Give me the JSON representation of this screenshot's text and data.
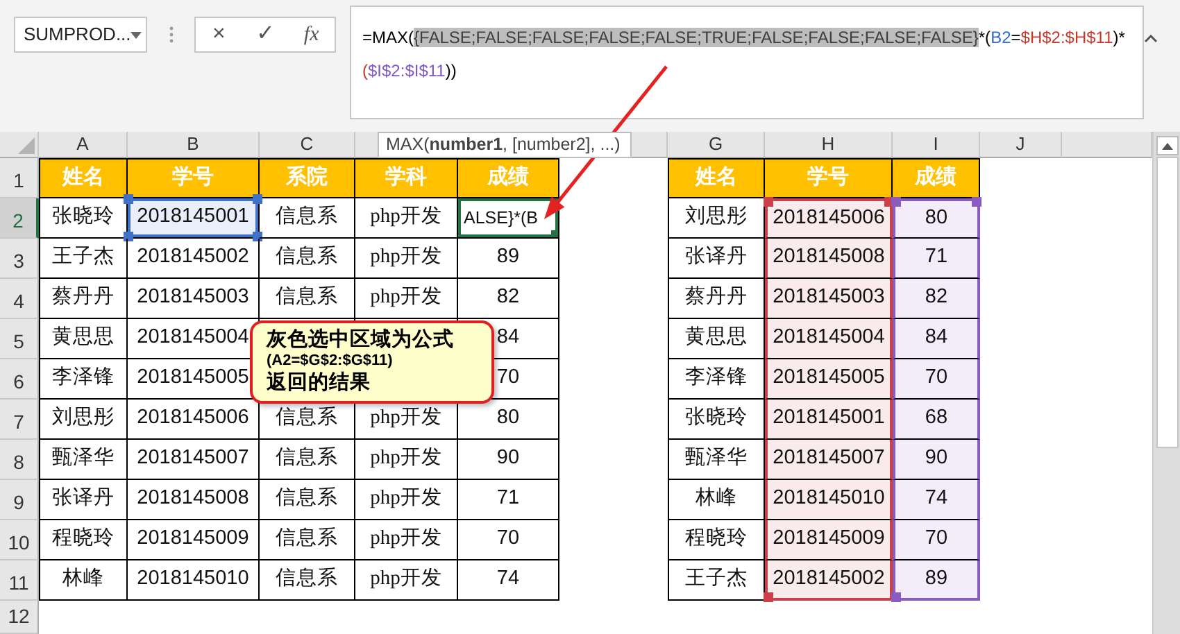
{
  "name_box": {
    "value": "SUMPROD..."
  },
  "formula_bar": {
    "cancel": "×",
    "enter": "✓",
    "function": "fx",
    "lines": [
      [
        {
          "text": "=MAX(",
          "color": "#000000",
          "selected": false
        },
        {
          "text": "{FALSE;FALSE;FALSE;FALSE;FALSE;TRUE;FALSE;FALSE;FALSE;FALSE}",
          "color": "#404040",
          "selected": true
        },
        {
          "text": "*(",
          "color": "#000000",
          "selected": false
        },
        {
          "text": "B2",
          "color": "#2f6cc4",
          "selected": false
        },
        {
          "text": "=",
          "color": "#000000",
          "selected": false
        },
        {
          "text": "$H$2:$H$11",
          "color": "#c0392b",
          "selected": false
        },
        {
          "text": ")*",
          "color": "#000000",
          "selected": false
        }
      ],
      [
        {
          "text": "(",
          "color": "#c0392b",
          "selected": false
        },
        {
          "text": "$I$2:$I$11",
          "color": "#7e57c2",
          "selected": false
        },
        {
          "text": "))",
          "color": "#000000",
          "selected": false
        }
      ]
    ]
  },
  "tooltip": {
    "text": "MAX(**number1**, [number2], ...)"
  },
  "columns": {
    "left": [
      "A",
      "B",
      "C"
    ],
    "right": [
      "G",
      "H",
      "I",
      "J"
    ]
  },
  "rows": [
    {
      "label": "1",
      "selected": false
    },
    {
      "label": "2",
      "selected": true
    },
    {
      "label": "3",
      "selected": false
    },
    {
      "label": "4",
      "selected": false
    },
    {
      "label": "5",
      "selected": false
    },
    {
      "label": "6",
      "selected": false
    },
    {
      "label": "7",
      "selected": false
    },
    {
      "label": "8",
      "selected": false
    },
    {
      "label": "9",
      "selected": false
    },
    {
      "label": "10",
      "selected": false
    },
    {
      "label": "11",
      "selected": false
    },
    {
      "label": "12",
      "selected": false
    }
  ],
  "left_table": {
    "headers": [
      "姓名",
      "学号",
      "系院",
      "学科",
      "成绩"
    ],
    "rows": [
      [
        {
          "text": "张晓玲",
          "referenced": false,
          "active": false
        },
        {
          "text": "2018145001",
          "referenced": true,
          "active": false
        },
        {
          "text": "信息系",
          "referenced": false,
          "active": false
        },
        {
          "text": "php开发",
          "referenced": false,
          "active": false
        },
        {
          "text": "ALSE}*(B",
          "referenced": false,
          "active": true
        }
      ],
      [
        {
          "text": "王子杰",
          "referenced": false,
          "active": false
        },
        {
          "text": "2018145002",
          "referenced": false,
          "active": false
        },
        {
          "text": "信息系",
          "referenced": false,
          "active": false
        },
        {
          "text": "php开发",
          "referenced": false,
          "active": false
        },
        {
          "text": "89",
          "referenced": false,
          "active": false
        }
      ],
      [
        {
          "text": "蔡丹丹",
          "referenced": false,
          "active": false
        },
        {
          "text": "2018145003",
          "referenced": false,
          "active": false
        },
        {
          "text": "信息系",
          "referenced": false,
          "active": false
        },
        {
          "text": "php开发",
          "referenced": false,
          "active": false
        },
        {
          "text": "82",
          "referenced": false,
          "active": false
        }
      ],
      [
        {
          "text": "黄思思",
          "referenced": false,
          "active": false
        },
        {
          "text": "2018145004",
          "referenced": false,
          "active": false
        },
        null,
        null,
        {
          "text": "84",
          "referenced": false,
          "active": false
        }
      ],
      [
        {
          "text": "李泽锋",
          "referenced": false,
          "active": false
        },
        {
          "text": "2018145005",
          "referenced": false,
          "active": false
        },
        null,
        null,
        {
          "text": "70",
          "referenced": false,
          "active": false
        }
      ],
      [
        {
          "text": "刘思彤",
          "referenced": false,
          "active": false
        },
        {
          "text": "2018145006",
          "referenced": false,
          "active": false
        },
        {
          "text": "信息系",
          "referenced": false,
          "active": false
        },
        {
          "text": "php开发",
          "referenced": false,
          "active": false
        },
        {
          "text": "80",
          "referenced": false,
          "active": false
        }
      ],
      [
        {
          "text": "甄泽华",
          "referenced": false,
          "active": false
        },
        {
          "text": "2018145007",
          "referenced": false,
          "active": false
        },
        {
          "text": "信息系",
          "referenced": false,
          "active": false
        },
        {
          "text": "php开发",
          "referenced": false,
          "active": false
        },
        {
          "text": "90",
          "referenced": false,
          "active": false
        }
      ],
      [
        {
          "text": "张译丹",
          "referenced": false,
          "active": false
        },
        {
          "text": "2018145008",
          "referenced": false,
          "active": false
        },
        {
          "text": "信息系",
          "referenced": false,
          "active": false
        },
        {
          "text": "php开发",
          "referenced": false,
          "active": false
        },
        {
          "text": "71",
          "referenced": false,
          "active": false
        }
      ],
      [
        {
          "text": "程晓玲",
          "referenced": false,
          "active": false
        },
        {
          "text": "2018145009",
          "referenced": false,
          "active": false
        },
        {
          "text": "信息系",
          "referenced": false,
          "active": false
        },
        {
          "text": "php开发",
          "referenced": false,
          "active": false
        },
        {
          "text": "70",
          "referenced": false,
          "active": false
        }
      ],
      [
        {
          "text": "林峰",
          "referenced": false,
          "active": false
        },
        {
          "text": "2018145010",
          "referenced": false,
          "active": false
        },
        {
          "text": "信息系",
          "referenced": false,
          "active": false
        },
        {
          "text": "php开发",
          "referenced": false,
          "active": false
        },
        {
          "text": "74",
          "referenced": false,
          "active": false
        }
      ]
    ]
  },
  "right_table": {
    "headers": [
      {
        "label": "姓名"
      },
      {
        "label": "学号",
        "color": "#c8414b"
      },
      {
        "label": "成绩",
        "color": "#8a5cc0"
      }
    ],
    "rows": [
      [
        "刘思彤",
        "2018145006",
        "80"
      ],
      [
        "张译丹",
        "2018145008",
        "71"
      ],
      [
        "蔡丹丹",
        "2018145003",
        "82"
      ],
      [
        "黄思思",
        "2018145004",
        "84"
      ],
      [
        "李泽锋",
        "2018145005",
        "70"
      ],
      [
        "张晓玲",
        "2018145001",
        "68"
      ],
      [
        "甄泽华",
        "2018145007",
        "90"
      ],
      [
        "林峰",
        "2018145010",
        "74"
      ],
      [
        "程晓玲",
        "2018145009",
        "70"
      ],
      [
        "王子杰",
        "2018145002",
        "89"
      ]
    ]
  },
  "callout": {
    "lines": [
      {
        "text": "灰色选中区域为公式",
        "kind": "title"
      },
      {
        "text": "(A2=$G$2:$G$11)",
        "kind": "note"
      },
      {
        "text": "返回的结果",
        "kind": "title"
      }
    ]
  }
}
